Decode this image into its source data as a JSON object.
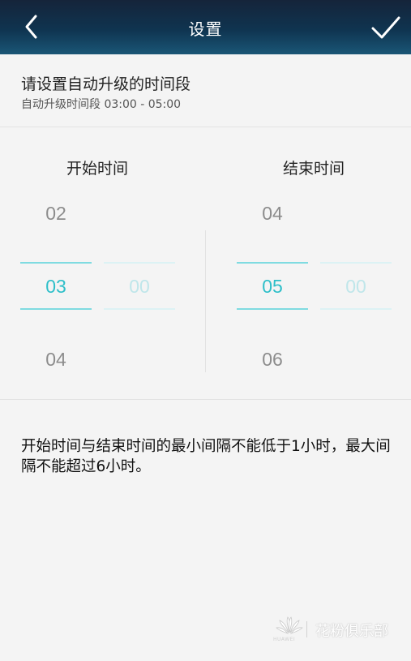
{
  "topbar": {
    "title": "设置",
    "back_icon": "chevron-left-icon",
    "confirm_icon": "check-icon"
  },
  "header": {
    "title": "请设置自动升级的时间段",
    "subtitle": "自动升级时间段 03:00 - 05:00"
  },
  "start": {
    "label": "开始时间",
    "hour_prev": "02",
    "hour": "03",
    "hour_next": "04",
    "minute": "00"
  },
  "end": {
    "label": "结束时间",
    "hour_prev": "04",
    "hour": "05",
    "hour_next": "06",
    "minute": "00"
  },
  "note": "开始时间与结束时间的最小间隔不能低于1小时，最大间隔不能超过6小时。",
  "watermark": {
    "text": "花粉俱乐部",
    "brand": "HUAWEI"
  },
  "colors": {
    "accent": "#2ebfc9",
    "header_bg": "#0f3450",
    "background": "#f4f4f4"
  }
}
